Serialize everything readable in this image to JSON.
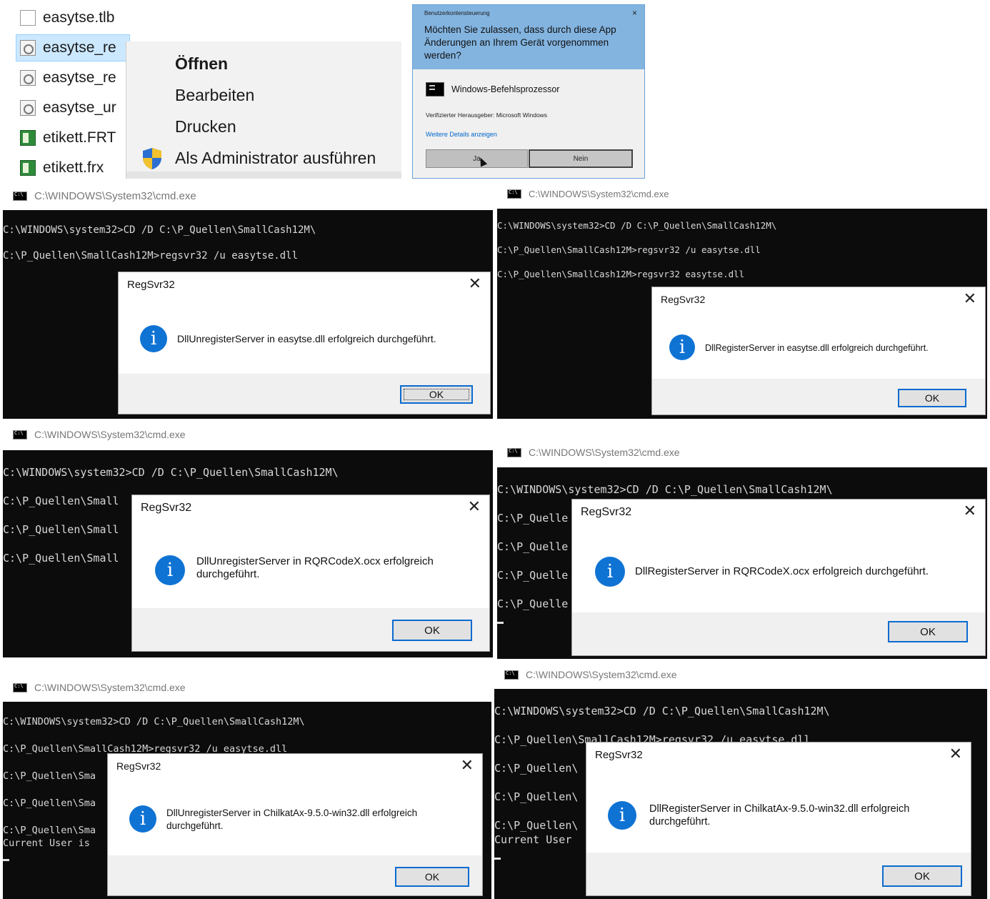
{
  "explorer": {
    "files": [
      {
        "name": "easytse.tlb",
        "icon": "document-icon"
      },
      {
        "name": "easytse_re",
        "icon": "config-file-icon",
        "selected": true
      },
      {
        "name": "easytse_re",
        "icon": "config-file-icon"
      },
      {
        "name": "easytse_ur",
        "icon": "config-file-icon"
      },
      {
        "name": "etikett.FRT",
        "icon": "report-file-icon"
      },
      {
        "name": "etikett.frx",
        "icon": "report-file-icon"
      }
    ],
    "context_menu": {
      "open": "Öffnen",
      "edit": "Bearbeiten",
      "print": "Drucken",
      "run_as_admin": "Als Administrator ausführen"
    }
  },
  "uac": {
    "header": "Benutzerkontensteuerung",
    "close": "×",
    "question": "Möchten Sie zulassen, dass durch diese App Änderungen an Ihrem Gerät vorgenommen werden?",
    "app_name": "Windows-Befehlsprozessor",
    "publisher": "Verifizierter Herausgeber: Microsoft Windows",
    "details_link": "Weitere Details anzeigen",
    "yes": "Ja",
    "no": "Nein"
  },
  "cmd_title": "C:\\WINDOWS\\System32\\cmd.exe",
  "dialog_title": "RegSvr32",
  "ok": "OK",
  "close_glyph": "✕",
  "info_glyph": "i",
  "windows": [
    {
      "lines": [
        "C:\\WINDOWS\\system32>CD /D C:\\P_Quellen\\SmallCash12M\\",
        "C:\\P_Quellen\\SmallCash12M>regsvr32 /u easytse.dll"
      ],
      "message": "DllUnregisterServer in easytse.dll erfolgreich durchgeführt."
    },
    {
      "lines": [
        "C:\\WINDOWS\\system32>CD /D C:\\P_Quellen\\SmallCash12M\\",
        "C:\\P_Quellen\\SmallCash12M>regsvr32 /u easytse.dll",
        "C:\\P_Quellen\\SmallCash12M>regsvr32 easytse.dll"
      ],
      "message": "DllRegisterServer in easytse.dll erfolgreich durchgeführt."
    },
    {
      "lines": [
        "C:\\WINDOWS\\system32>CD /D C:\\P_Quellen\\SmallCash12M\\",
        "C:\\P_Quellen\\Small",
        "C:\\P_Quellen\\Small",
        "C:\\P_Quellen\\Small"
      ],
      "message": "DllUnregisterServer in RQRCodeX.ocx erfolgreich durchgeführt."
    },
    {
      "lines": [
        "C:\\WINDOWS\\system32>CD /D C:\\P_Quellen\\SmallCash12M\\",
        "C:\\P_Quelle",
        "C:\\P_Quelle",
        "C:\\P_Quelle",
        "C:\\P_Quelle"
      ],
      "message": "DllRegisterServer in RQRCodeX.ocx erfolgreich durchgeführt."
    },
    {
      "lines": [
        "C:\\WINDOWS\\system32>CD /D C:\\P_Quellen\\SmallCash12M\\",
        "C:\\P_Quellen\\SmallCash12M>regsvr32 /u easytse.dll",
        "C:\\P_Quellen\\Sma",
        "C:\\P_Quellen\\Sma",
        "C:\\P_Quellen\\Sma",
        "Current User is"
      ],
      "message": "DllUnregisterServer in ChilkatAx-9.5.0-win32.dll erfolgreich durchgeführt."
    },
    {
      "lines": [
        "C:\\WINDOWS\\system32>CD /D C:\\P_Quellen\\SmallCash12M\\",
        "C:\\P_Quellen\\SmallCash12M>regsvr32 /u easytse.dll",
        "C:\\P_Quellen\\",
        "C:\\P_Quellen\\",
        "C:\\P_Quellen\\",
        "Current User"
      ],
      "message": "DllRegisterServer in ChilkatAx-9.5.0-win32.dll erfolgreich durchgeführt."
    }
  ]
}
